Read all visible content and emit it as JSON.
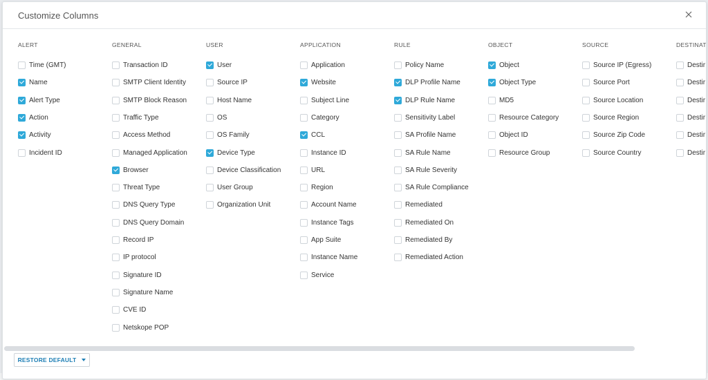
{
  "modal": {
    "title": "Customize Columns",
    "restore_label": "RESTORE DEFAULT",
    "accent_color": "#2fa9d9",
    "link_color": "#1e7fb5"
  },
  "columns": [
    {
      "header": "ALERT",
      "items": [
        {
          "label": "Time (GMT)",
          "checked": false
        },
        {
          "label": "Name",
          "checked": true
        },
        {
          "label": "Alert Type",
          "checked": true
        },
        {
          "label": "Action",
          "checked": true
        },
        {
          "label": "Activity",
          "checked": true
        },
        {
          "label": "Incident ID",
          "checked": false
        }
      ]
    },
    {
      "header": "GENERAL",
      "items": [
        {
          "label": "Transaction ID",
          "checked": false
        },
        {
          "label": "SMTP Client Identity",
          "checked": false
        },
        {
          "label": "SMTP Block Reason",
          "checked": false
        },
        {
          "label": "Traffic Type",
          "checked": false
        },
        {
          "label": "Access Method",
          "checked": false
        },
        {
          "label": "Managed Application",
          "checked": false
        },
        {
          "label": "Browser",
          "checked": true
        },
        {
          "label": "Threat Type",
          "checked": false
        },
        {
          "label": "DNS Query Type",
          "checked": false
        },
        {
          "label": "DNS Query Domain",
          "checked": false
        },
        {
          "label": "Record IP",
          "checked": false
        },
        {
          "label": "IP protocol",
          "checked": false
        },
        {
          "label": "Signature ID",
          "checked": false
        },
        {
          "label": "Signature Name",
          "checked": false
        },
        {
          "label": "CVE ID",
          "checked": false
        },
        {
          "label": "Netskope POP",
          "checked": false
        }
      ]
    },
    {
      "header": "USER",
      "items": [
        {
          "label": "User",
          "checked": true
        },
        {
          "label": "Source IP",
          "checked": false
        },
        {
          "label": "Host Name",
          "checked": false
        },
        {
          "label": "OS",
          "checked": false
        },
        {
          "label": "OS Family",
          "checked": false
        },
        {
          "label": "Device Type",
          "checked": true
        },
        {
          "label": "Device Classification",
          "checked": false
        },
        {
          "label": "User Group",
          "checked": false
        },
        {
          "label": "Organization Unit",
          "checked": false
        }
      ]
    },
    {
      "header": "APPLICATION",
      "items": [
        {
          "label": "Application",
          "checked": false
        },
        {
          "label": "Website",
          "checked": true
        },
        {
          "label": "Subject Line",
          "checked": false
        },
        {
          "label": "Category",
          "checked": false
        },
        {
          "label": "CCL",
          "checked": true
        },
        {
          "label": "Instance ID",
          "checked": false
        },
        {
          "label": "URL",
          "checked": false
        },
        {
          "label": "Region",
          "checked": false
        },
        {
          "label": "Account Name",
          "checked": false
        },
        {
          "label": "Instance Tags",
          "checked": false
        },
        {
          "label": "App Suite",
          "checked": false
        },
        {
          "label": "Instance Name",
          "checked": false
        },
        {
          "label": "Service",
          "checked": false
        }
      ]
    },
    {
      "header": "RULE",
      "items": [
        {
          "label": "Policy Name",
          "checked": false
        },
        {
          "label": "DLP Profile Name",
          "checked": true
        },
        {
          "label": "DLP Rule Name",
          "checked": true
        },
        {
          "label": "Sensitivity Label",
          "checked": false
        },
        {
          "label": "SA Profile Name",
          "checked": false
        },
        {
          "label": "SA Rule Name",
          "checked": false
        },
        {
          "label": "SA Rule Severity",
          "checked": false
        },
        {
          "label": "SA Rule Compliance",
          "checked": false
        },
        {
          "label": "Remediated",
          "checked": false
        },
        {
          "label": "Remediated On",
          "checked": false
        },
        {
          "label": "Remediated By",
          "checked": false
        },
        {
          "label": "Remediated Action",
          "checked": false
        }
      ]
    },
    {
      "header": "OBJECT",
      "items": [
        {
          "label": "Object",
          "checked": true
        },
        {
          "label": "Object Type",
          "checked": true
        },
        {
          "label": "MD5",
          "checked": false
        },
        {
          "label": "Resource Category",
          "checked": false
        },
        {
          "label": "Object ID",
          "checked": false
        },
        {
          "label": "Resource Group",
          "checked": false
        }
      ]
    },
    {
      "header": "SOURCE",
      "items": [
        {
          "label": "Source IP (Egress)",
          "checked": false
        },
        {
          "label": "Source Port",
          "checked": false
        },
        {
          "label": "Source Location",
          "checked": false
        },
        {
          "label": "Source Region",
          "checked": false
        },
        {
          "label": "Source Zip Code",
          "checked": false
        },
        {
          "label": "Source Country",
          "checked": false
        }
      ]
    },
    {
      "header": "DESTINATI",
      "items": [
        {
          "label": "Destir",
          "checked": false
        },
        {
          "label": "Destir",
          "checked": false
        },
        {
          "label": "Destir",
          "checked": false
        },
        {
          "label": "Destir",
          "checked": false
        },
        {
          "label": "Destir",
          "checked": false
        },
        {
          "label": "Destir",
          "checked": false
        }
      ]
    }
  ]
}
